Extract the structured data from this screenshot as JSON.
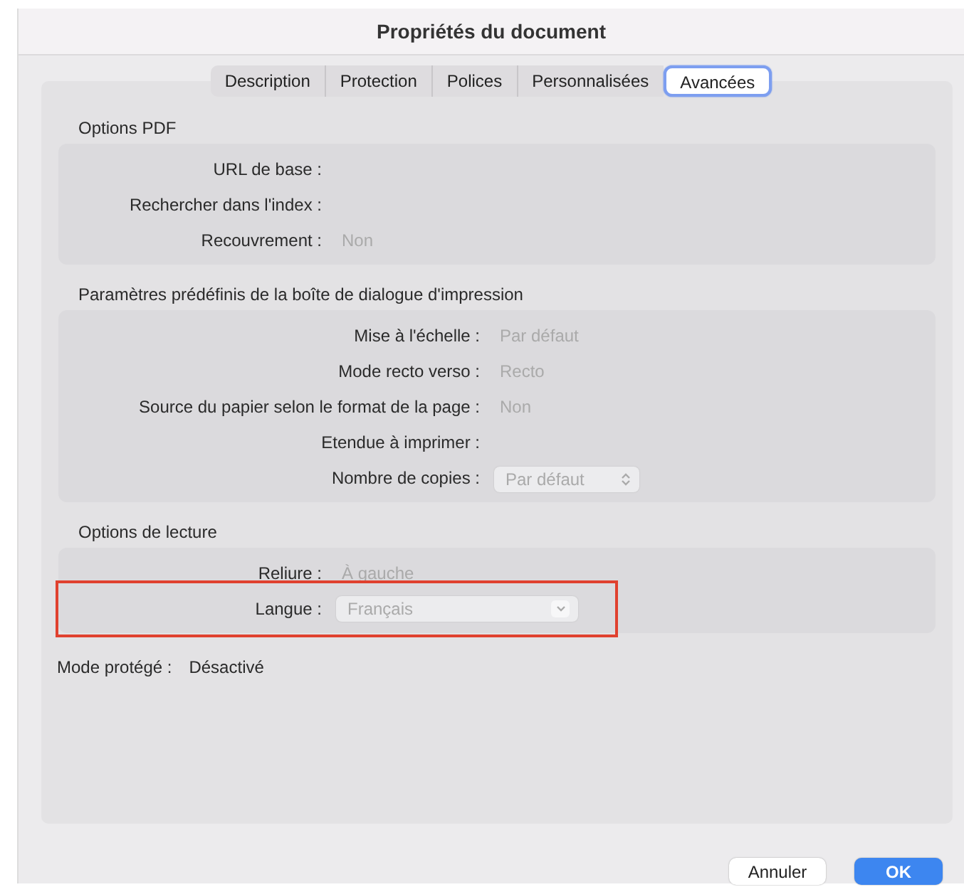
{
  "window": {
    "title": "Propriétés du document"
  },
  "tabs": [
    {
      "label": "Description",
      "selected": false
    },
    {
      "label": "Protection",
      "selected": false
    },
    {
      "label": "Polices",
      "selected": false
    },
    {
      "label": "Personnalisées",
      "selected": false
    },
    {
      "label": "Avancées",
      "selected": true
    }
  ],
  "sections": [
    {
      "title": "Options PDF",
      "rows": [
        {
          "kind": "text",
          "label": "URL de base :",
          "highlighted": false
        },
        {
          "kind": "text",
          "label": "Rechercher dans l'index :",
          "highlighted": false
        },
        {
          "kind": "text",
          "label": "Recouvrement :",
          "value": "Non",
          "highlighted": false
        }
      ]
    },
    {
      "title": "Paramètres prédéfinis de la boîte de dialogue d'impression",
      "rows": [
        {
          "kind": "text",
          "label": "Mise à l'échelle :",
          "value": "Par défaut",
          "highlighted": false
        },
        {
          "kind": "text",
          "label": "Mode recto verso :",
          "value": "Recto",
          "highlighted": false
        },
        {
          "kind": "text",
          "label": "Source du papier selon le format de la page :",
          "value": "Non",
          "highlighted": false
        },
        {
          "kind": "text",
          "label": "Etendue à imprimer :",
          "highlighted": false
        },
        {
          "kind": "stepper",
          "label": "Nombre de copies :",
          "value": "Par défaut",
          "highlighted": false
        }
      ]
    },
    {
      "title": "Options de lecture",
      "rows": [
        {
          "kind": "text",
          "label": "Reliure :",
          "value": "À gauche",
          "highlighted": false
        },
        {
          "kind": "dropdown",
          "label": "Langue :",
          "value": "Français",
          "highlighted": true
        }
      ]
    }
  ],
  "protected_mode": {
    "label": "Mode protégé :",
    "value": "Désactivé"
  },
  "buttons": [
    {
      "label": "Annuler",
      "kind": "secondary"
    },
    {
      "label": "OK",
      "kind": "primary"
    }
  ]
}
